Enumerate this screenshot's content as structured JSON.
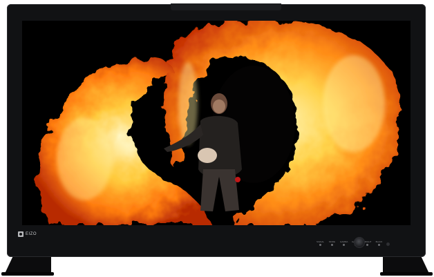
{
  "brand": {
    "logo_text": "EIZO"
  },
  "controls": [
    "SIGNAL",
    "MODE",
    "GAMMA",
    "GAMUT",
    "BRIGHT",
    "BLACK",
    "ENTER",
    "BR",
    "PW"
  ],
  "colors": {
    "bezel": "#111214",
    "fire_core": "#ffe27a",
    "fire_mid": "#ff9f1c",
    "fire_edge": "#d4370a"
  },
  "icons": [
    "eizo-logo-icon",
    "control-knob-icon",
    "power-icon"
  ]
}
